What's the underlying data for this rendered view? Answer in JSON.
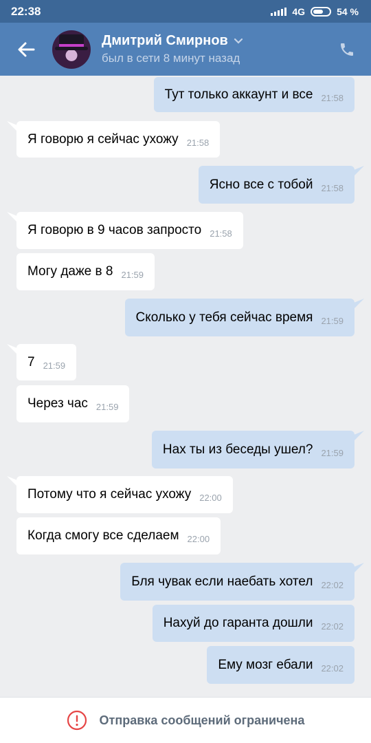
{
  "status_bar": {
    "time": "22:38",
    "network": "4G",
    "battery": "54 %"
  },
  "header": {
    "contact_name": "Дмитрий Смирнов",
    "presence": "был в сети 8 минут назад",
    "icons": [
      "back-arrow-icon",
      "chevron-down-icon",
      "phone-icon"
    ]
  },
  "messages": [
    {
      "dir": "out",
      "text": "Тут только аккаунт и все",
      "time": "21:58"
    },
    {
      "dir": "in",
      "text": "Я говорю я сейчас ухожу",
      "time": "21:58"
    },
    {
      "dir": "out",
      "text": "Ясно все с тобой",
      "time": "21:58"
    },
    {
      "dir": "in",
      "text": "Я говорю в 9 часов запросто",
      "time": "21:58"
    },
    {
      "dir": "in",
      "text": "Могу даже в 8",
      "time": "21:59"
    },
    {
      "dir": "out",
      "text": "Сколько у тебя сейчас время",
      "time": "21:59"
    },
    {
      "dir": "in",
      "text": "7",
      "time": "21:59"
    },
    {
      "dir": "in",
      "text": "Через час",
      "time": "21:59"
    },
    {
      "dir": "out",
      "text": "Нах ты из беседы ушел?",
      "time": "21:59"
    },
    {
      "dir": "in",
      "text": "Потому что я сейчас ухожу",
      "time": "22:00"
    },
    {
      "dir": "in",
      "text": "Когда смогу все сделаем",
      "time": "22:00"
    },
    {
      "dir": "out",
      "text": "Бля чувак если наебать хотел",
      "time": "22:02"
    },
    {
      "dir": "out",
      "text": "Нахуй до гаранта дошли",
      "time": "22:02"
    },
    {
      "dir": "out",
      "text": "Ему мозг ебали",
      "time": "22:02"
    }
  ],
  "bottom_bar": {
    "notice": "Отправка сообщений ограничена",
    "icon": "alert-circle-icon",
    "icon_color": "#e64646"
  },
  "colors": {
    "status_bar": "#3c6797",
    "header": "#5181b8",
    "background": "#edeef0",
    "incoming_bubble": "#ffffff",
    "outgoing_bubble": "#cddef2"
  }
}
